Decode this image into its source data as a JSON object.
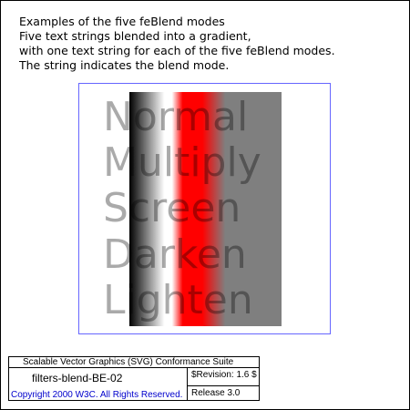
{
  "description": {
    "lines": [
      "Examples of the five feBlend modes",
      "Five text strings blended into a gradient,",
      "with one text string for each of the five feBlend modes.",
      "The string indicates the blend mode."
    ]
  },
  "blend_words": [
    "Normal",
    "Multiply",
    "Screen",
    "Darken",
    "Lighten"
  ],
  "gradient_colors": [
    "#000000",
    "#ffffff",
    "#ff0000",
    "#7f7f7f"
  ],
  "footer": {
    "suite_title": "Scalable Vector Graphics (SVG) Conformance Suite",
    "test_name": "filters-blend-BE-02",
    "revision": "$Revision: 1.6 $",
    "copyright": "Copyright 2000 W3C. All Rights Reserved.",
    "release": "Release 3.0"
  },
  "colors": {
    "canvas_border": "#6666ff",
    "copyright_text": "#0000cc"
  }
}
